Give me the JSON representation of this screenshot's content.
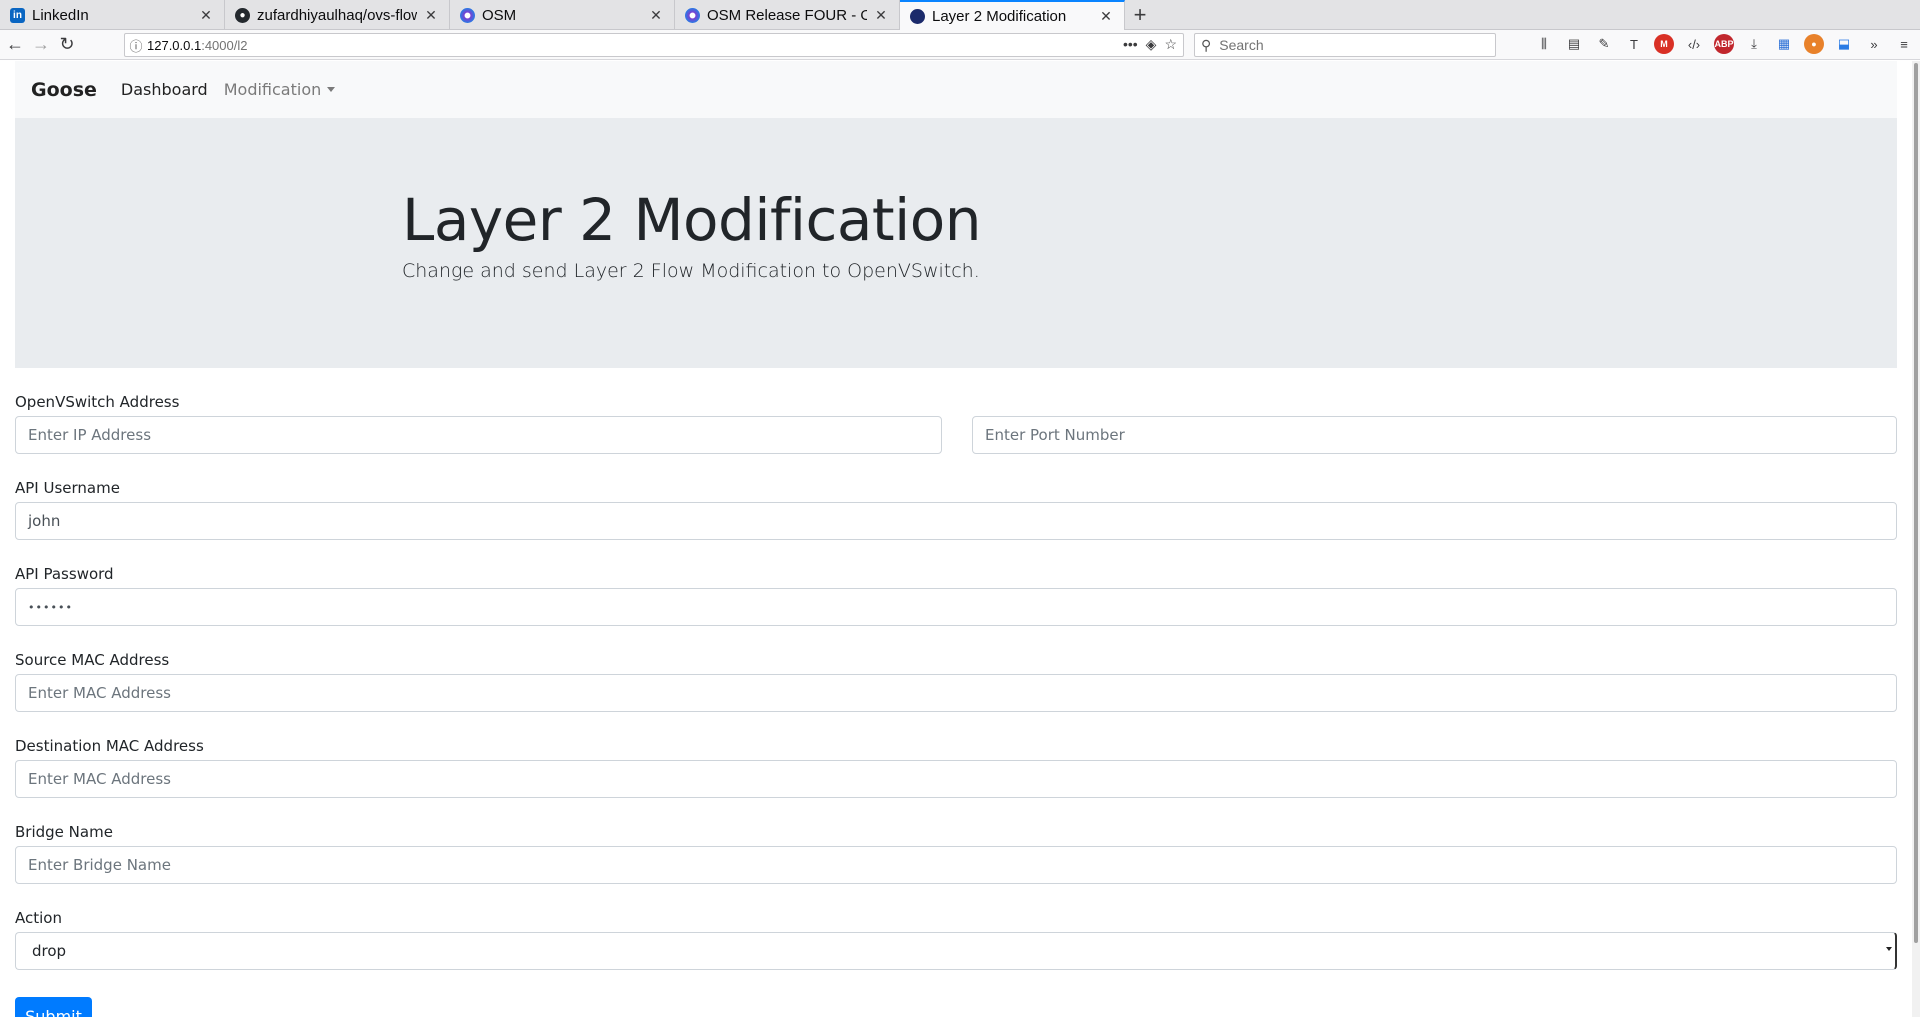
{
  "browser": {
    "tabs": [
      {
        "title": "LinkedIn",
        "icon": "linkedin-icon",
        "active": false
      },
      {
        "title": "zufardhiyaulhaq/ovs-flow",
        "icon": "github-icon",
        "active": false
      },
      {
        "title": "OSM",
        "icon": "osm-icon",
        "active": false
      },
      {
        "title": "OSM Release FOUR - OSM",
        "icon": "osm-icon",
        "active": false
      },
      {
        "title": "Layer 2 Modification",
        "icon": "page-icon",
        "active": true
      }
    ],
    "url_host": "127.0.0.1",
    "url_path": ":4000/l2",
    "search_placeholder": "Search",
    "accent": "#0a84ff"
  },
  "app": {
    "brand": "Goose",
    "nav": {
      "dashboard": "Dashboard",
      "modification": "Modification"
    }
  },
  "hero": {
    "title": "Layer 2 Modification",
    "lead": "Change and send Layer 2 Flow Modification to OpenVSwitch."
  },
  "form": {
    "ovs_label": "OpenVSwitch Address",
    "ip_placeholder": "Enter IP Address",
    "port_placeholder": "Enter Port Number",
    "username_label": "API Username",
    "username_value": "john",
    "password_label": "API Password",
    "password_value": "••••••",
    "src_mac_label": "Source MAC Address",
    "src_mac_placeholder": "Enter MAC Address",
    "dst_mac_label": "Destination MAC Address",
    "dst_mac_placeholder": "Enter MAC Address",
    "bridge_label": "Bridge Name",
    "bridge_placeholder": "Enter Bridge Name",
    "action_label": "Action",
    "action_value": "drop",
    "submit_label": "Submit",
    "primary_color": "#007bff"
  }
}
